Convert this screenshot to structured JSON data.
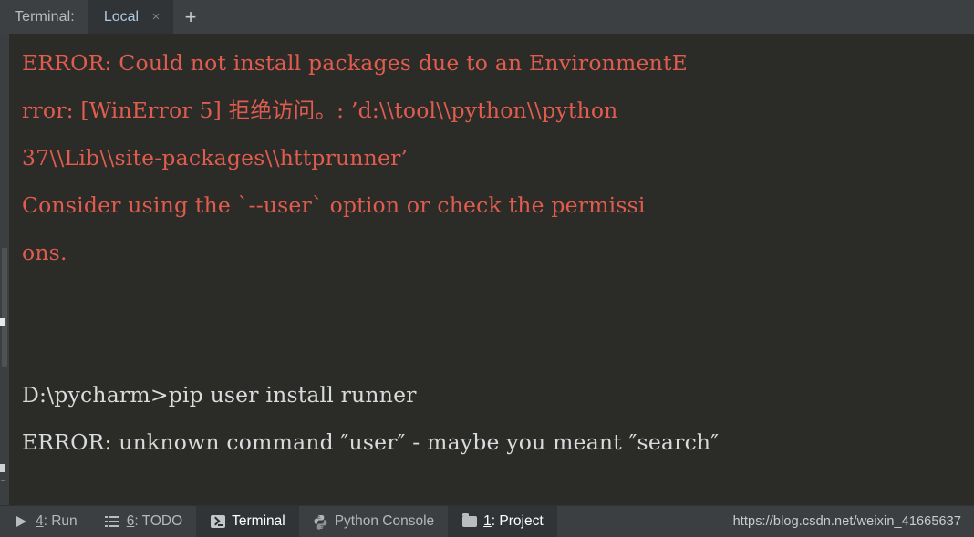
{
  "window": {
    "background": "#3c3f41",
    "terminal_background": "#2b2b28",
    "error_color": "#e05c4e",
    "output_color": "#d8dbdc",
    "accent_color": "#a9c7e0"
  },
  "tabbar": {
    "title": "Terminal:",
    "tabs": [
      {
        "label": "Local",
        "close_glyph": "×",
        "active": true
      }
    ],
    "add_glyph": "+"
  },
  "terminal": {
    "lines": [
      {
        "text": "ERROR: Could not install packages due to an EnvironmentE",
        "style": "err"
      },
      {
        "text": "rror: [WinError 5] 拒绝访问。: ’d:\\\\tool\\\\python\\\\python",
        "style": "err"
      },
      {
        "text": "37\\\\Lib\\\\site-packages\\\\httprunner’",
        "style": "err"
      },
      {
        "text": "Consider using the `--user` option or check the permissi",
        "style": "err"
      },
      {
        "text": "ons.",
        "style": "err"
      },
      {
        "text": "",
        "style": "blank"
      },
      {
        "text": "",
        "style": "blank"
      },
      {
        "text": "D:\\pycharm>pip user install runner",
        "style": "out"
      },
      {
        "text": "ERROR: unknown command ″user″ - maybe you meant ″search″",
        "style": "out"
      }
    ]
  },
  "statusbar": {
    "buttons": [
      {
        "icon": "play-icon",
        "shortcut": "4",
        "label": ": Run",
        "active": false,
        "name": "status-button-run"
      },
      {
        "icon": "todo-list-icon",
        "shortcut": "6",
        "label": ": TODO",
        "active": false,
        "name": "status-button-todo"
      },
      {
        "icon": "terminal-icon",
        "shortcut": "",
        "label": "Terminal",
        "active": true,
        "name": "status-button-terminal"
      },
      {
        "icon": "python-icon",
        "shortcut": "",
        "label": "Python Console",
        "active": false,
        "name": "status-button-python-console"
      },
      {
        "icon": "folder-icon",
        "shortcut": "1",
        "label": ": Project",
        "active": true,
        "name": "status-button-project"
      }
    ],
    "watermark": "https://blog.csdn.net/weixin_41665637"
  }
}
